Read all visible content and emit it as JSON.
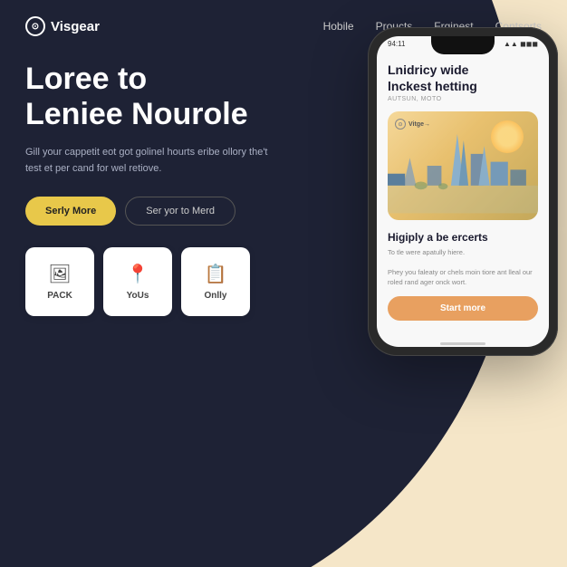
{
  "brand": {
    "logo_text": "Visgear",
    "logo_icon": "⊙"
  },
  "nav": {
    "items": [
      {
        "label": "Hobile",
        "id": "nav-hobile"
      },
      {
        "label": "Proucts",
        "id": "nav-proucts"
      },
      {
        "label": "Frginest",
        "id": "nav-frginest"
      },
      {
        "label": "Contsorts",
        "id": "nav-contsorts"
      }
    ]
  },
  "hero": {
    "heading_line1": "Loree to",
    "heading_line2": "Leniee Nourole",
    "description": "Gill your cappetit eot got golinel hourts eribe ollory the't test et per cand for wel retiove.",
    "btn_primary": "Serly More",
    "btn_secondary": "Ser yor to Merd"
  },
  "icon_cards": [
    {
      "id": "pack",
      "label": "PACK",
      "icon": "🖼"
    },
    {
      "id": "yous",
      "label": "YoUs",
      "icon": "📍"
    },
    {
      "id": "onlly",
      "label": "Onlly",
      "icon": "📋"
    }
  ],
  "phone": {
    "status_left": "94:11",
    "status_right": "▲▲▼",
    "card_brand": "Vitge→",
    "title_line1": "Lnidricy wide",
    "title_line2": "lnckest hetting",
    "subtitle": "AUTSUN, MOTO",
    "desc_title": "Higiply a be ercerts",
    "desc_text1": "To tle were apatully hiere.",
    "desc_text2": "Phey you faleaty or chels moin tiore ant lleal our roled rand ager onck wort.",
    "btn_start": "Start more"
  },
  "colors": {
    "bg_dark": "#1e2235",
    "bg_light": "#f5e6c8",
    "accent_yellow": "#e8c84a",
    "accent_orange": "#e8a060",
    "text_white": "#ffffff",
    "text_muted": "#aab0c4"
  }
}
